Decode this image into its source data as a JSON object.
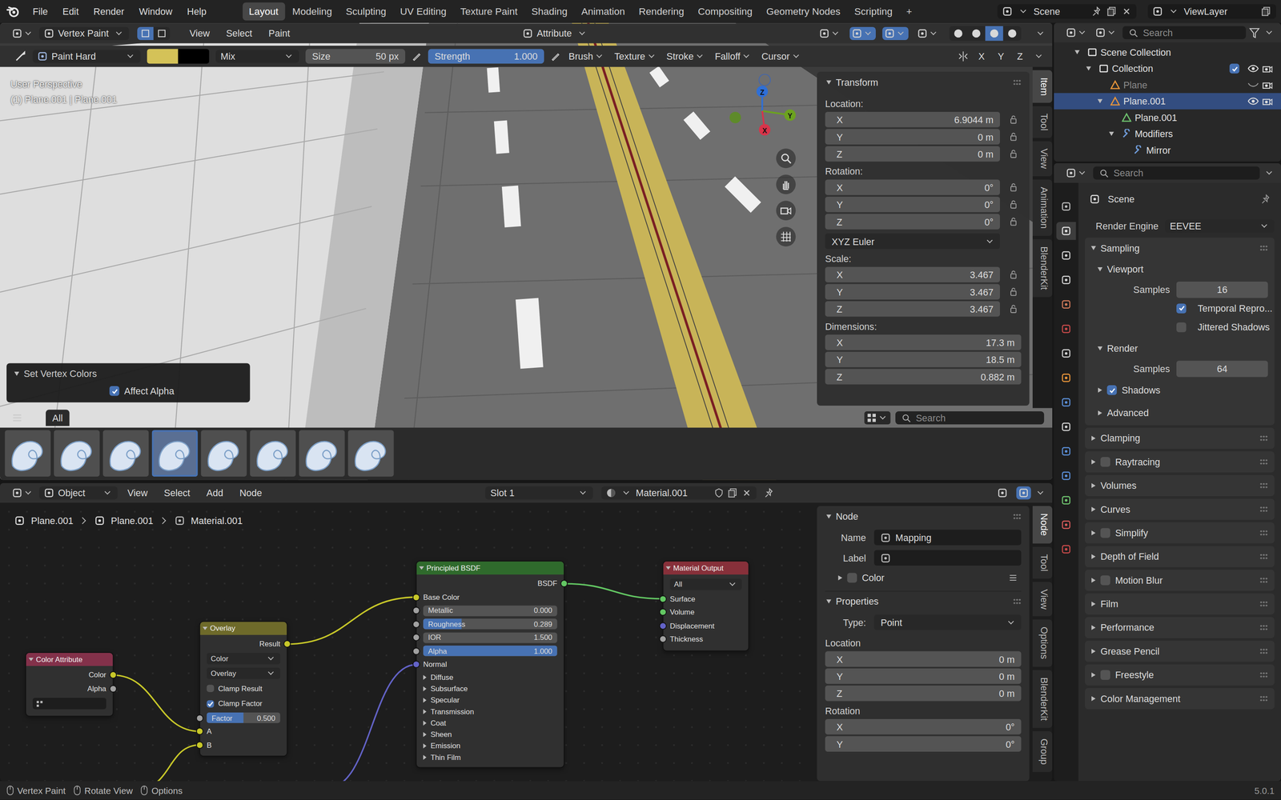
{
  "menubar": {
    "menus": [
      "File",
      "Edit",
      "Render",
      "Window",
      "Help"
    ],
    "workspaces": [
      {
        "label": "Layout",
        "selected": true
      },
      {
        "label": "Modeling",
        "selected": false
      },
      {
        "label": "Sculpting",
        "selected": false
      },
      {
        "label": "UV Editing",
        "selected": false
      },
      {
        "label": "Texture Paint",
        "selected": false
      },
      {
        "label": "Shading",
        "selected": false
      },
      {
        "label": "Animation",
        "selected": false
      },
      {
        "label": "Rendering",
        "selected": false
      },
      {
        "label": "Compositing",
        "selected": false
      },
      {
        "label": "Geometry Nodes",
        "selected": false
      },
      {
        "label": "Scripting",
        "selected": false
      }
    ],
    "add_workspace": "+",
    "scene": "Scene",
    "view_layer": "ViewLayer"
  },
  "viewport": {
    "header": {
      "mode": "Vertex Paint",
      "mask_modes": [
        {
          "selected": true
        },
        {
          "selected": false
        }
      ],
      "menus": [
        "View",
        "Select",
        "Paint"
      ],
      "attribute": "Attribute",
      "toggles": [
        {
          "selected": false
        },
        {
          "selected": true
        },
        {
          "selected": true
        },
        {
          "selected": false
        }
      ],
      "shading_modes": [
        {
          "selected": false
        },
        {
          "selected": false
        },
        {
          "selected": true
        },
        {
          "selected": false
        }
      ]
    },
    "tool_settings": {
      "brush": "Paint Hard",
      "colors": [
        {
          "color": "#d4c258"
        },
        {
          "color": "#000000"
        }
      ],
      "blend": "Mix",
      "size": {
        "label": "Size",
        "value": "50 px"
      },
      "strength": {
        "label": "Strength",
        "value": "1.000",
        "level": 1
      },
      "menus": [
        "Brush",
        "Texture",
        "Stroke",
        "Falloff",
        "Cursor"
      ],
      "symmetry": [
        "X",
        "Y",
        "Z"
      ]
    },
    "overlay_text": [
      "User Perspective",
      "(1) Plane.001 | Plane.001"
    ],
    "gizmo": [
      {
        "axis": "Z",
        "color": "#2f6fd6"
      },
      {
        "axis": "Y",
        "color": "#6ca21f"
      },
      {
        "axis": "X",
        "color": "#d8344a"
      }
    ],
    "sidebar": {
      "tabs": [
        {
          "label": "Item",
          "selected": true
        },
        {
          "label": "Tool",
          "selected": false
        },
        {
          "label": "View",
          "selected": false
        },
        {
          "label": "Animation",
          "selected": false
        },
        {
          "label": "BlenderKit",
          "selected": false
        }
      ],
      "panel": "Transform",
      "groups": [
        {
          "label": "Location:",
          "fields": [
            {
              "axis": "X",
              "value": "6.9044 m",
              "locked": false
            },
            {
              "axis": "Y",
              "value": "0 m",
              "locked": false
            },
            {
              "axis": "Z",
              "value": "0 m",
              "locked": false
            }
          ]
        },
        {
          "label": "Rotation:",
          "fields": [
            {
              "axis": "X",
              "value": "0°",
              "locked": false
            },
            {
              "axis": "Y",
              "value": "0°",
              "locked": false
            },
            {
              "axis": "Z",
              "value": "0°",
              "locked": false
            }
          ],
          "mode": "XYZ Euler"
        },
        {
          "label": "Scale:",
          "fields": [
            {
              "axis": "X",
              "value": "3.467",
              "locked": false
            },
            {
              "axis": "Y",
              "value": "3.467",
              "locked": false
            },
            {
              "axis": "Z",
              "value": "3.467",
              "locked": false
            }
          ]
        },
        {
          "label": "Dimensions:",
          "fields": [
            {
              "axis": "X",
              "value": "17.3 m"
            },
            {
              "axis": "Y",
              "value": "18.5 m"
            },
            {
              "axis": "Z",
              "value": "0.882 m"
            }
          ]
        }
      ]
    },
    "operator_panel": {
      "title": "Set Vertex Colors",
      "expanded": true,
      "options": [
        {
          "label": "Affect Alpha",
          "checked": true
        }
      ]
    },
    "asset_shelf": {
      "tabs": [
        {
          "label": "All",
          "selected": true
        }
      ],
      "search": "Search",
      "brushes": [
        {
          "selected": false
        },
        {
          "selected": false
        },
        {
          "selected": false
        },
        {
          "selected": true
        },
        {
          "selected": false
        },
        {
          "selected": false
        },
        {
          "selected": false
        },
        {
          "selected": false
        }
      ]
    }
  },
  "node_editor": {
    "header": {
      "mode": "Object",
      "menus": [
        "View",
        "Select",
        "Add",
        "Node"
      ],
      "slot": "Slot 1",
      "material": "Material.001",
      "toggles": [
        {
          "selected": false
        },
        {
          "selected": true
        }
      ]
    },
    "breadcrumbs": [
      "Plane.001",
      "Plane.001",
      "Material.001"
    ],
    "nodes": [
      {
        "title": "Color Attribute",
        "color": "#83314a",
        "rows": [
          {
            "kind": "output",
            "label": "Color",
            "socket": "#c7c729"
          },
          {
            "kind": "output",
            "label": "Alpha",
            "socket": "#a1a1a1"
          },
          {
            "kind": "attr",
            "value": ""
          }
        ]
      },
      {
        "title": "Overlay",
        "color": "#6e6a2a",
        "rows": [
          {
            "kind": "output",
            "label": "Result",
            "socket": "#c7c729"
          },
          {
            "kind": "dropdown",
            "value": "Color"
          },
          {
            "kind": "dropdown",
            "value": "Overlay"
          },
          {
            "kind": "checkbox",
            "label": "Clamp Result",
            "checked": false
          },
          {
            "kind": "checkbox",
            "label": "Clamp Factor",
            "checked": true
          },
          {
            "kind": "slider",
            "label": "Factor",
            "value": "0.500",
            "level": 0.5,
            "socket": "#a1a1a1"
          },
          {
            "kind": "input",
            "label": "A",
            "socket": "#c7c729"
          },
          {
            "kind": "input",
            "label": "B",
            "socket": "#c7c729"
          }
        ]
      },
      {
        "title": "Principled BSDF",
        "color": "#2f6a2c",
        "rows": [
          {
            "kind": "output",
            "label": "BSDF",
            "socket": "#63c763"
          },
          {
            "kind": "input",
            "label": "Base Color",
            "socket": "#c7c729"
          },
          {
            "kind": "slider",
            "label": "Metallic",
            "value": "0.000",
            "level": 0,
            "socket": "#a1a1a1"
          },
          {
            "kind": "slider",
            "label": "Roughness",
            "value": "0.289",
            "level": 0.289,
            "socket": "#a1a1a1"
          },
          {
            "kind": "field",
            "label": "IOR",
            "value": "1.500",
            "socket": "#a1a1a1"
          },
          {
            "kind": "slider",
            "label": "Alpha",
            "value": "1.000",
            "level": 1,
            "socket": "#a1a1a1"
          },
          {
            "kind": "input",
            "label": "Normal",
            "socket": "#6363c7"
          },
          {
            "kind": "panel",
            "label": "Diffuse",
            "expanded": false
          },
          {
            "kind": "panel",
            "label": "Subsurface",
            "expanded": false
          },
          {
            "kind": "panel",
            "label": "Specular",
            "expanded": false
          },
          {
            "kind": "panel",
            "label": "Transmission",
            "expanded": false
          },
          {
            "kind": "panel",
            "label": "Coat",
            "expanded": false
          },
          {
            "kind": "panel",
            "label": "Sheen",
            "expanded": false
          },
          {
            "kind": "panel",
            "label": "Emission",
            "expanded": false
          },
          {
            "kind": "panel",
            "label": "Thin Film",
            "expanded": false
          }
        ]
      },
      {
        "title": "Material Output",
        "color": "#87303a",
        "rows": [
          {
            "kind": "dropdown",
            "value": "All"
          },
          {
            "kind": "input",
            "label": "Surface",
            "socket": "#63c763"
          },
          {
            "kind": "input",
            "label": "Volume",
            "socket": "#63c763"
          },
          {
            "kind": "input",
            "label": "Displacement",
            "socket": "#6363c7"
          },
          {
            "kind": "input",
            "label": "Thickness",
            "socket": "#a1a1a1"
          }
        ]
      }
    ],
    "links": [
      {
        "from": [
          "Color Attribute",
          "Color"
        ],
        "to": [
          "Overlay",
          "A"
        ],
        "color": "#c7c729"
      },
      {
        "from": null,
        "to": [
          "Overlay",
          "B"
        ],
        "color": "#c7c729"
      },
      {
        "from": [
          "Overlay",
          "Result"
        ],
        "to": [
          "Principled BSDF",
          "Base Color"
        ],
        "color": "#c7c729"
      },
      {
        "from": null,
        "to": [
          "Principled BSDF",
          "Normal"
        ],
        "color": "#6363c7"
      },
      {
        "from": [
          "Principled BSDF",
          "BSDF"
        ],
        "to": [
          "Material Output",
          "Surface"
        ],
        "color": "#63c763"
      }
    ],
    "sidebar": {
      "tabs": [
        {
          "label": "Node",
          "selected": true
        },
        {
          "label": "Tool",
          "selected": false
        },
        {
          "label": "View",
          "selected": false
        },
        {
          "label": "Options",
          "selected": false
        },
        {
          "label": "BlenderKit",
          "selected": false
        },
        {
          "label": "Group",
          "selected": false
        }
      ],
      "node_panel": {
        "title": "Node",
        "name": {
          "label": "Name",
          "value": "Mapping"
        },
        "label": {
          "label": "Label",
          "value": ""
        },
        "color": {
          "label": "Color",
          "expanded": false,
          "checked": false
        }
      },
      "properties": {
        "title": "Properties",
        "type": {
          "label": "Type:",
          "value": "Point"
        },
        "groups": [
          {
            "label": "Location",
            "fields": [
              {
                "axis": "X",
                "value": "0 m"
              },
              {
                "axis": "Y",
                "value": "0 m"
              },
              {
                "axis": "Z",
                "value": "0 m"
              }
            ]
          },
          {
            "label": "Rotation",
            "fields": [
              {
                "axis": "X",
                "value": "0°"
              },
              {
                "axis": "Y",
                "value": "0°"
              }
            ]
          }
        ]
      }
    }
  },
  "outliner": {
    "search": "Search",
    "tree": [
      {
        "label": "Scene Collection",
        "kind": "scene",
        "expanded": true,
        "selected": false,
        "children": [
          {
            "label": "Collection",
            "kind": "collection",
            "expanded": true,
            "selected": false,
            "included": true,
            "visible": true,
            "renderable": true,
            "children": [
              {
                "label": "Plane",
                "kind": "object",
                "expanded": false,
                "selected": false,
                "dimmed": true,
                "visible": false,
                "renderable": true
              },
              {
                "label": "Plane.001",
                "kind": "object",
                "expanded": true,
                "selected": true,
                "visible": true,
                "renderable": true,
                "children": [
                  {
                    "label": "Plane.001",
                    "kind": "mesh",
                    "expanded": false,
                    "selected": false
                  },
                  {
                    "label": "Modifiers",
                    "kind": "modifiers",
                    "expanded": true,
                    "selected": false,
                    "children": [
                      {
                        "label": "Mirror",
                        "kind": "modifier",
                        "selected": false
                      }
                    ]
                  }
                ]
              }
            ]
          }
        ]
      }
    ]
  },
  "properties": {
    "search": "Search",
    "tabs": [
      {
        "selected": false
      },
      {
        "selected": true
      },
      {
        "selected": false
      },
      {
        "selected": false
      },
      {
        "selected": false
      },
      {
        "selected": false
      },
      {
        "selected": false
      },
      {
        "selected": false
      },
      {
        "selected": false
      },
      {
        "selected": false
      },
      {
        "selected": false
      },
      {
        "selected": false
      },
      {
        "selected": false
      },
      {
        "selected": false
      },
      {
        "selected": false
      }
    ],
    "context": "Scene",
    "render_engine": {
      "label": "Render Engine",
      "value": "EEVEE"
    },
    "panels": [
      {
        "label": "Sampling",
        "expanded": true,
        "subpanels": [
          {
            "label": "Viewport",
            "expanded": true,
            "rows": [
              {
                "kind": "number",
                "label": "Samples",
                "value": "16"
              },
              {
                "kind": "checkbox",
                "label": "Temporal Repro...",
                "checked": true
              },
              {
                "kind": "checkbox",
                "label": "Jittered Shadows",
                "checked": false
              }
            ]
          },
          {
            "label": "Render",
            "expanded": true,
            "rows": [
              {
                "kind": "number",
                "label": "Samples",
                "value": "64"
              }
            ]
          },
          {
            "label": "Shadows",
            "expanded": false,
            "checked": true,
            "rows": []
          },
          {
            "label": "Advanced",
            "expanded": false,
            "rows": []
          }
        ]
      },
      {
        "label": "Clamping",
        "expanded": false,
        "subpanels": []
      },
      {
        "label": "Raytracing",
        "expanded": false,
        "checked": false,
        "subpanels": []
      },
      {
        "label": "Volumes",
        "expanded": false,
        "subpanels": []
      },
      {
        "label": "Curves",
        "expanded": false,
        "subpanels": []
      },
      {
        "label": "Simplify",
        "expanded": false,
        "checked": false,
        "subpanels": []
      },
      {
        "label": "Depth of Field",
        "expanded": false,
        "subpanels": []
      },
      {
        "label": "Motion Blur",
        "expanded": false,
        "checked": false,
        "subpanels": []
      },
      {
        "label": "Film",
        "expanded": false,
        "subpanels": []
      },
      {
        "label": "Performance",
        "expanded": false,
        "subpanels": []
      },
      {
        "label": "Grease Pencil",
        "expanded": false,
        "subpanels": []
      },
      {
        "label": "Freestyle",
        "expanded": false,
        "checked": false,
        "subpanels": []
      },
      {
        "label": "Color Management",
        "expanded": false,
        "subpanels": []
      }
    ]
  },
  "status_bar": {
    "items": [
      "Vertex Paint",
      "Rotate View",
      "Options"
    ],
    "version": "5.0.1"
  }
}
